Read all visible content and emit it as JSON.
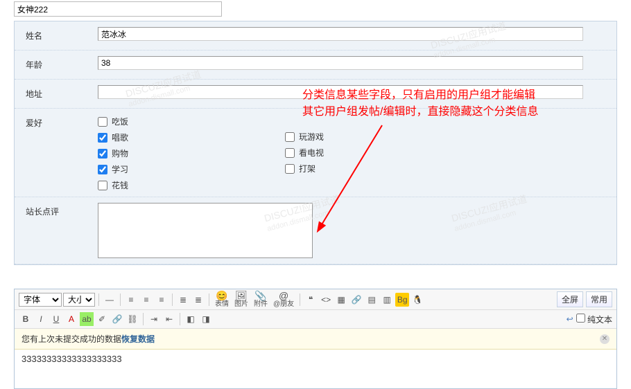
{
  "titleInput": "女神222",
  "fields": {
    "name_label": "姓名",
    "name_value": "范冰冰",
    "age_label": "年龄",
    "age_value": "38",
    "address_label": "地址",
    "address_value": "",
    "hobby_label": "爱好",
    "review_label": "站长点评"
  },
  "hobbies_left": [
    {
      "label": "吃饭",
      "checked": false
    },
    {
      "label": "唱歌",
      "checked": true
    },
    {
      "label": "购物",
      "checked": true
    },
    {
      "label": "学习",
      "checked": true
    },
    {
      "label": "花钱",
      "checked": false
    }
  ],
  "hobbies_right": [
    {
      "label": "玩游戏",
      "checked": false
    },
    {
      "label": "看电视",
      "checked": false
    },
    {
      "label": "打架",
      "checked": false
    }
  ],
  "annotation_line1": "分类信息某些字段，只有启用的用户组才能编辑",
  "annotation_line2": "其它用户组发帖/编辑时，直接隐藏这个分类信息",
  "watermark_main": "DISCUZ!应用试道",
  "watermark_sub": "addon.dismall.com",
  "editor": {
    "font_label": "字体",
    "size_label": "大小",
    "emoji_label": "表情",
    "image_label": "图片",
    "attach_label": "附件",
    "at_label": "@朋友",
    "fullscreen": "全屏",
    "common": "常用",
    "plain": "纯文本",
    "notice_prefix": "您有上次未提交成功的数据 ",
    "notice_link": "恢复数据",
    "body": "33333333333333333333"
  }
}
